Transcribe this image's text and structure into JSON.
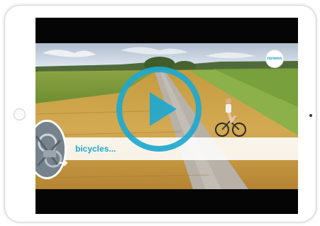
{
  "video": {
    "caption": "bicycles...",
    "logo_text": "nsnews",
    "play_button": "play-icon"
  },
  "colors": {
    "accent": "#1ea8cf",
    "letterbox": "#050505"
  }
}
